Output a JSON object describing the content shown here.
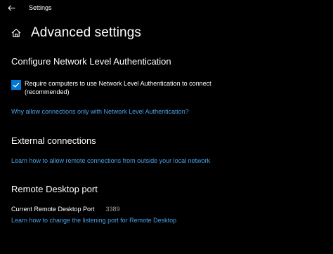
{
  "window": {
    "app_title": "Settings"
  },
  "page": {
    "title": "Advanced settings"
  },
  "nla": {
    "heading": "Configure Network Level Authentication",
    "checkbox_label": "Require computers to use Network Level Authentication to connect (recommended)",
    "checkbox_checked": true,
    "help_link": "Why allow connections only with Network Level Authentication?"
  },
  "external": {
    "heading": "External connections",
    "help_link": "Learn how to allow remote connections from outside your local network"
  },
  "port": {
    "heading": "Remote Desktop port",
    "label": "Current Remote Desktop Port",
    "value": "3389",
    "help_link": "Learn how to change the listening port for Remote Desktop"
  },
  "colors": {
    "background": "#000000",
    "accent": "#0078d7",
    "link": "#4aa0e6",
    "text": "#ffffff",
    "secondary_text": "#a0a0a0"
  },
  "icons": {
    "back": "back-arrow-icon",
    "home": "home-icon",
    "check": "checkmark-icon"
  }
}
